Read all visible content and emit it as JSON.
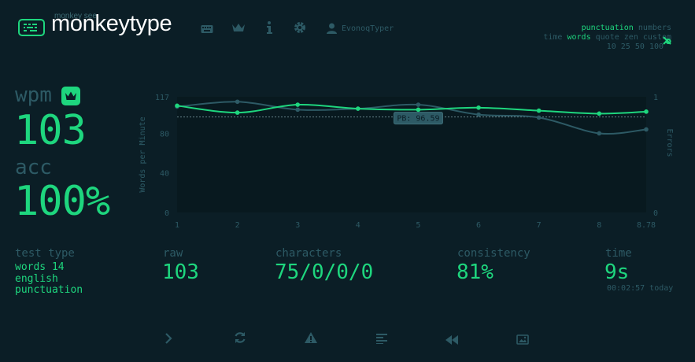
{
  "header": {
    "logo_top": "monkey see",
    "logo_text": "monkeytype",
    "nav_icons": [
      "keyboard-icon",
      "crown-icon",
      "info-icon",
      "gear-icon",
      "user-icon"
    ],
    "username": "EvonoqTyper"
  },
  "modes": {
    "row1": [
      "punctuation",
      "numbers"
    ],
    "row2": [
      "time",
      "words",
      "quote",
      "zen",
      "custom"
    ],
    "row3": [
      "10",
      "25",
      "50",
      "100"
    ],
    "active": [
      "punctuation",
      "words"
    ]
  },
  "result": {
    "wpm_label": "wpm",
    "wpm": "103",
    "acc_label": "acc",
    "acc": "100%"
  },
  "stats": {
    "test_type_label": "test type",
    "test_type_lines": [
      "words 14",
      "english",
      "punctuation"
    ],
    "raw_label": "raw",
    "raw": "103",
    "characters_label": "characters",
    "characters": "75/0/0/0",
    "consistency_label": "consistency",
    "consistency": "81%",
    "time_label": "time",
    "time": "9s",
    "time_detail": "00:02:57 today"
  },
  "colors": {
    "accent": "#1ed67e",
    "sub": "#2d5a65",
    "bg": "#0b1e26"
  },
  "chart_data": {
    "type": "line",
    "ylabel": "Words per Minute",
    "y2label": "Errors",
    "ylim": [
      0,
      117
    ],
    "y_ticks": [
      "117",
      "80",
      "40",
      "0"
    ],
    "y_tick_values": [
      117,
      80,
      40,
      0
    ],
    "y2_ticks": [
      "1",
      "0"
    ],
    "x": [
      1,
      2,
      3,
      4,
      5,
      6,
      7,
      8,
      8.78
    ],
    "x_tick_labels": [
      "1",
      "2",
      "3",
      "4",
      "5",
      "6",
      "7",
      "8",
      "8.78"
    ],
    "series": [
      {
        "values": [
          108,
          101,
          109,
          105,
          104,
          106,
          103,
          100,
          102
        ],
        "color": "#1ed67e"
      },
      {
        "values": [
          107,
          112,
          104,
          105,
          109,
          99,
          96,
          80,
          84
        ],
        "color": "#2d5a65"
      }
    ],
    "annotation": {
      "label": "PB: 96.59",
      "value": 96.59
    },
    "grid": false
  }
}
